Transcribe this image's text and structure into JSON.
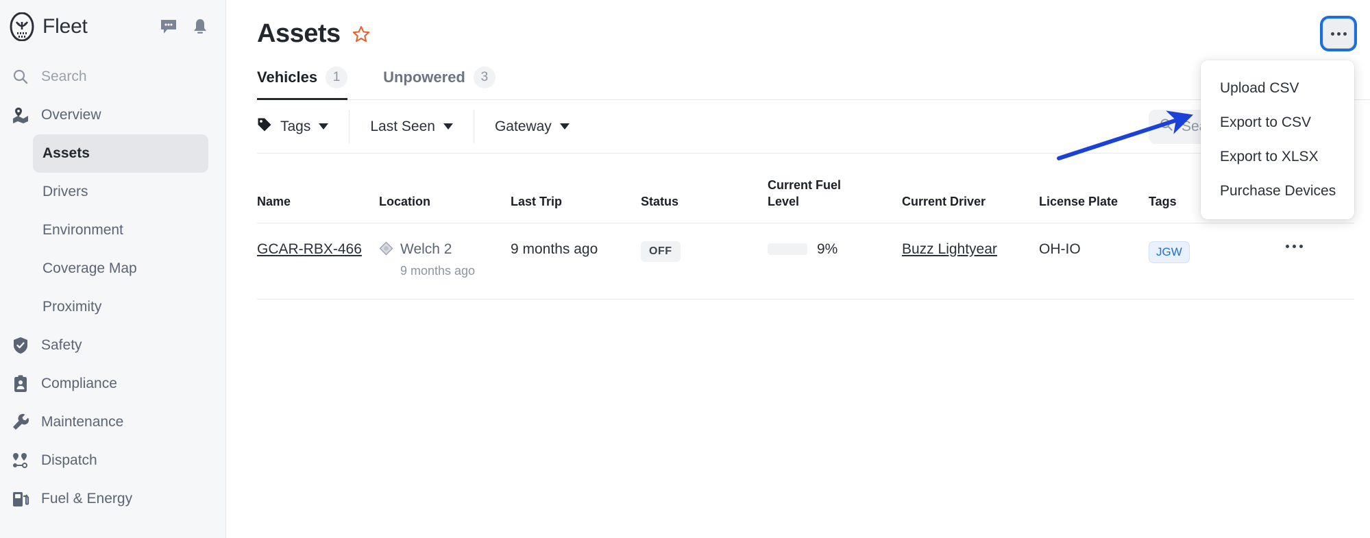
{
  "sidebar": {
    "brand": "Fleet",
    "icons": [
      {
        "name": "chat-icon"
      },
      {
        "name": "bell-icon"
      }
    ],
    "search_label": "Search",
    "items": [
      {
        "label": "Overview",
        "icon": "map-pin-icon",
        "type": "main"
      },
      {
        "label": "Assets",
        "type": "sub",
        "active": true
      },
      {
        "label": "Drivers",
        "type": "sub"
      },
      {
        "label": "Environment",
        "type": "sub"
      },
      {
        "label": "Coverage Map",
        "type": "sub"
      },
      {
        "label": "Proximity",
        "type": "sub"
      },
      {
        "label": "Safety",
        "icon": "shield-check-icon",
        "type": "main"
      },
      {
        "label": "Compliance",
        "icon": "clipboard-person-icon",
        "type": "main"
      },
      {
        "label": "Maintenance",
        "icon": "wrench-icon",
        "type": "main"
      },
      {
        "label": "Dispatch",
        "icon": "route-pins-icon",
        "type": "main"
      },
      {
        "label": "Fuel & Energy",
        "icon": "fuel-pump-icon",
        "type": "main"
      }
    ]
  },
  "header": {
    "title": "Assets",
    "star_icon": "star-outline-icon",
    "star_color": "#e8622c",
    "kebab_icon": "ellipsis-icon"
  },
  "tabs": [
    {
      "label": "Vehicles",
      "count": "1",
      "active": true
    },
    {
      "label": "Unpowered",
      "count": "3",
      "active": false
    }
  ],
  "filters": [
    {
      "label": "Tags",
      "icon": "tag-icon"
    },
    {
      "label": "Last Seen",
      "icon": ""
    },
    {
      "label": "Gateway",
      "icon": ""
    }
  ],
  "search": {
    "placeholder": "Search veh",
    "icon": "search-icon",
    "value": ""
  },
  "menu": {
    "items": [
      {
        "label": "Upload CSV"
      },
      {
        "label": "Export to CSV"
      },
      {
        "label": "Export to XLSX"
      },
      {
        "label": "Purchase Devices"
      }
    ]
  },
  "table": {
    "columns": [
      "Name",
      "Location",
      "Last Trip",
      "Status",
      "Current Fuel Level",
      "Current Driver",
      "License Plate",
      "Tags"
    ],
    "fuel_header_line1": "Current Fuel",
    "fuel_header_line2": "Level",
    "rows": [
      {
        "name": "GCAR-RBX-466",
        "location_icon": "location-diamond-icon",
        "location": "Welch 2",
        "location_time": "9 months ago",
        "last_trip": "9 months ago",
        "status": "OFF",
        "fuel_pct_text": "9%",
        "fuel_pct_value": 9,
        "driver": "Buzz Lightyear",
        "license_plate": "OH-IO",
        "tag": "JGW",
        "row_menu_icon": "ellipsis-icon"
      }
    ]
  },
  "annotation": {
    "type": "arrow",
    "color": "#1b41d8",
    "points_to": "Export to CSV"
  },
  "colors": {
    "accent_blue": "#1a6fdb",
    "star_orange": "#e8622c",
    "fuel_red": "#b3131b",
    "tag_blue": "#1a6fdb"
  }
}
